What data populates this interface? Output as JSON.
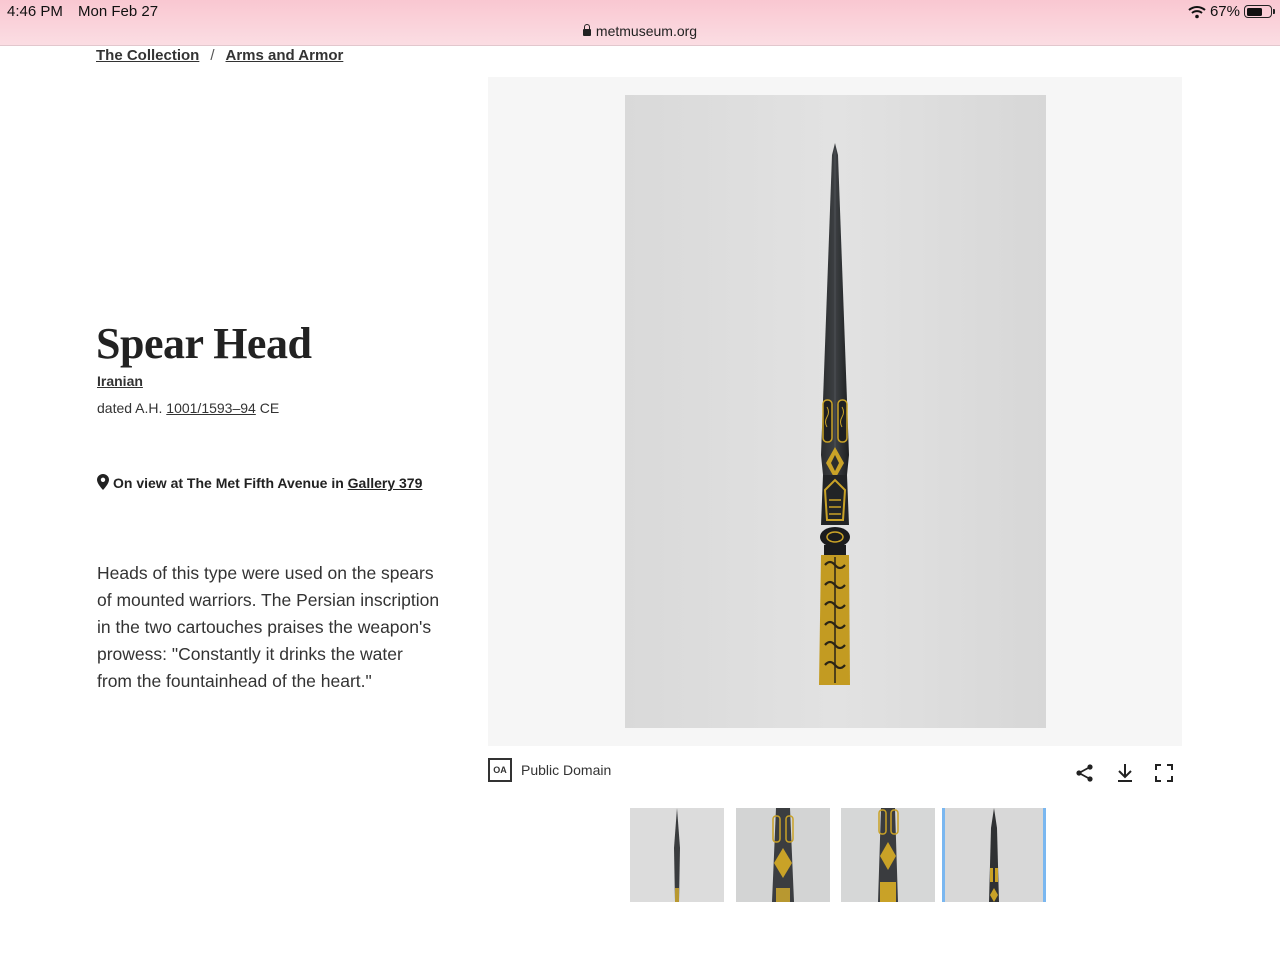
{
  "status_bar": {
    "time": "4:46 PM",
    "date": "Mon Feb 27",
    "battery": "67%",
    "battery_level": 0.67,
    "url": "metmuseum.org"
  },
  "breadcrumb": {
    "items": [
      "The Collection",
      "Arms and Armor"
    ],
    "separator": "/"
  },
  "object": {
    "title": "Spear Head",
    "culture": "Iranian",
    "date_prefix": "dated A.H. ",
    "date_link": "1001/1593–94",
    "date_suffix": " CE",
    "on_view_text": "On view at The Met Fifth Avenue in ",
    "gallery_link": "Gallery 379",
    "description": "Heads of this type were used on the spears of mounted warriors. The Persian inscription in the two cartouches praises the weapon's prowess: \"Constantly it drinks the water from the fountainhead of the heart.\""
  },
  "image_panel": {
    "rights_badge": "OA",
    "rights_label": "Public Domain",
    "tools": [
      "share-icon",
      "download-icon",
      "fullscreen-icon"
    ],
    "thumbnail_count": 4,
    "active_thumbnail": 4
  },
  "colors": {
    "status_bar": "#f9c7d1",
    "accent_thumb_border": "#7ab7f0",
    "gold": "#c9a227"
  }
}
